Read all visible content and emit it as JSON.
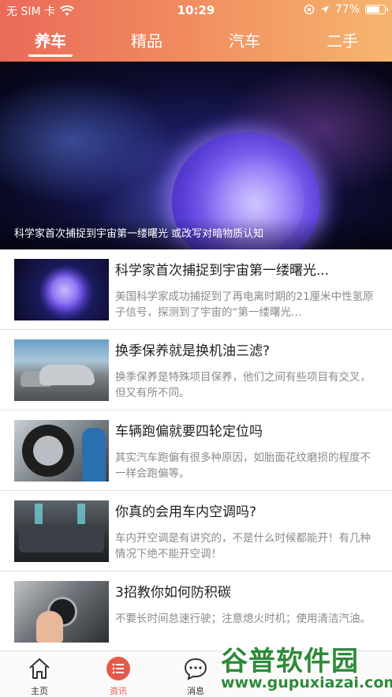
{
  "status_bar": {
    "carrier": "无 SIM 卡",
    "time": "10:29",
    "battery": "77%",
    "battery_level": 0.77
  },
  "top_tabs": [
    {
      "label": "养车",
      "active": true
    },
    {
      "label": "精品",
      "active": false
    },
    {
      "label": "汽车",
      "active": false
    },
    {
      "label": "二手",
      "active": false
    }
  ],
  "banner": {
    "caption": "科学家首次捕捉到宇宙第一缕曙光 或改写对暗物质认知"
  },
  "articles": [
    {
      "title": "科学家首次捕捉到宇宙第一缕曙光...",
      "desc": "美国科学家成功捕捉到了再电离时期的21厘米中性氢原子信号，探测到了宇宙的“第一缕曙光…",
      "thumb": "space-sun-image"
    },
    {
      "title": "换季保养就是换机油三滤?",
      "desc": "换季保养是特殊项目保养，他们之间有些项目有交叉，但又有所不同。",
      "thumb": "cars-on-road-image"
    },
    {
      "title": "车辆跑偏就要四轮定位吗",
      "desc": "其实汽车跑偏有很多种原因，如胎面花纹磨损的程度不一样会跑偏等。",
      "thumb": "tire-service-image"
    },
    {
      "title": "你真的会用车内空调吗?",
      "desc": "车内开空调是有讲究的，不是什么时候都能开！有几种情况下绝不能开空调！",
      "thumb": "car-interior-ac-image"
    },
    {
      "title": "3招教你如何防积碳",
      "desc": "不要长时间怠速行驶；注意熄火时机；使用清洁汽油。",
      "thumb": "engine-start-button-image"
    }
  ],
  "tab_bar": [
    {
      "label": "主页",
      "icon": "home-icon",
      "active": false
    },
    {
      "label": "资讯",
      "icon": "news-list-icon",
      "active": true
    },
    {
      "label": "消息",
      "icon": "chat-bubble-icon",
      "active": false
    }
  ],
  "watermark": {
    "text": "谷普软件园",
    "url": "www.gupuxiazai.com"
  },
  "colors": {
    "accent": "#e8584a",
    "header_start": "#ea6a5a",
    "header_end": "#f6b56f"
  }
}
